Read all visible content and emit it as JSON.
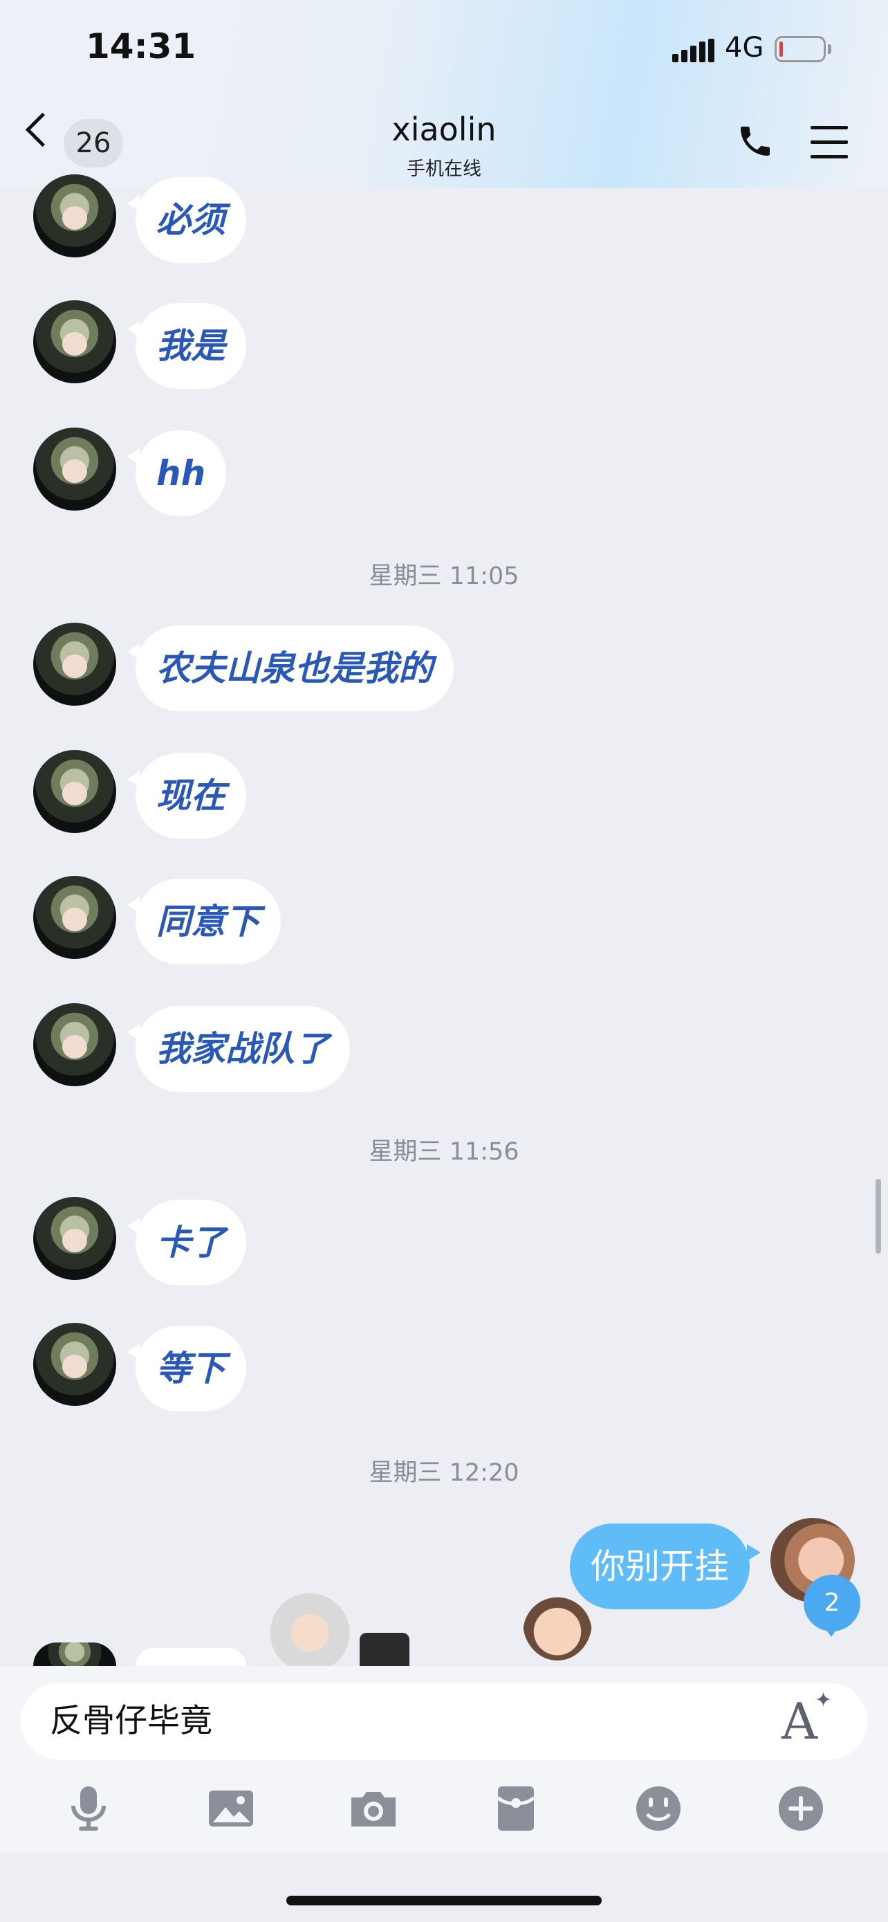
{
  "statusbar": {
    "time": "14:31",
    "network": "4G"
  },
  "header": {
    "unread_count": "26",
    "title": "xiaolin",
    "subtitle": "手机在线"
  },
  "messages": [
    {
      "text": "必须"
    },
    {
      "text": "我是"
    },
    {
      "text": "hh"
    },
    {
      "timestamp": "星期三 11:05"
    },
    {
      "text": "农夫山泉也是我的"
    },
    {
      "text": "现在"
    },
    {
      "text": "同意下"
    },
    {
      "text": "我家战队了"
    },
    {
      "timestamp": "星期三 11:56"
    },
    {
      "text": "卡了"
    },
    {
      "text": "等下"
    },
    {
      "timestamp": "星期三 12:20"
    },
    {
      "text": "你别开挂",
      "from_me": true
    }
  ],
  "my_avatar_badge": "2",
  "input": {
    "value": "反骨仔毕竟"
  },
  "toolbar": [
    "mic-icon",
    "image-icon",
    "camera-icon",
    "red-packet-icon",
    "emoji-icon",
    "plus-icon"
  ]
}
